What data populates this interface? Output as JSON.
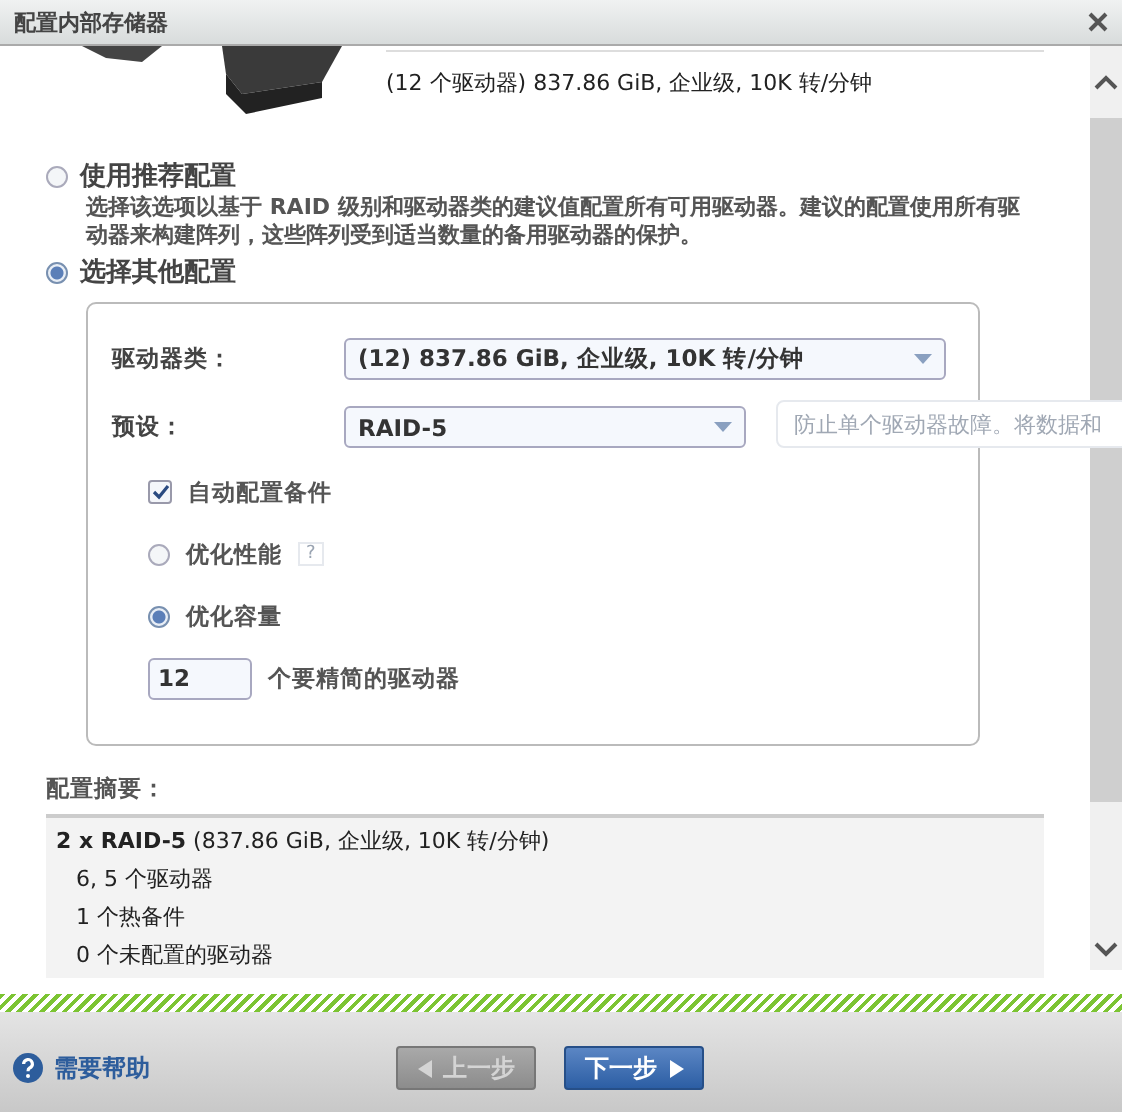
{
  "window": {
    "title": "配置内部存储器"
  },
  "drive": {
    "description": "(12 个驱动器) 837.86 GiB, 企业级, 10K 转/分钟"
  },
  "options": [
    {
      "label": "使用推荐配置",
      "description": "选择该选项以基于 RAID 级别和驱动器类的建议值配置所有可用驱动器。建议的配置使用所有驱动器来构建阵列，这些阵列受到适当数量的备用驱动器的保护。",
      "selected": false
    },
    {
      "label": "选择其他配置",
      "selected": true
    }
  ],
  "config": {
    "drive_class": {
      "label": "驱动器类：",
      "value": "(12) 837.86 GiB, 企业级, 10K 转/分钟"
    },
    "preset": {
      "label": "预设：",
      "value": "RAID-5",
      "tooltip": "防止单个驱动器故障。将数据和"
    },
    "auto_spare": {
      "label": "自动配置备件",
      "checked": true
    },
    "optimize": [
      {
        "label": "优化性能",
        "selected": false,
        "help": "?"
      },
      {
        "label": "优化容量",
        "selected": true
      }
    ],
    "drive_count": {
      "value": "12",
      "label": "个要精简的驱动器"
    }
  },
  "summary": {
    "title": "配置摘要：",
    "headline": "**2 x RAID-5** (837.86 GiB, 企业级, 10K 转/分钟)",
    "lines": [
      "6, 5 个驱动器",
      "1 个热备件",
      "0 个未配置的驱动器"
    ]
  },
  "footer": {
    "help": "需要帮助",
    "back": {
      "label": "上一步",
      "disabled": true
    },
    "next": {
      "label": "下一步",
      "disabled": false
    }
  }
}
